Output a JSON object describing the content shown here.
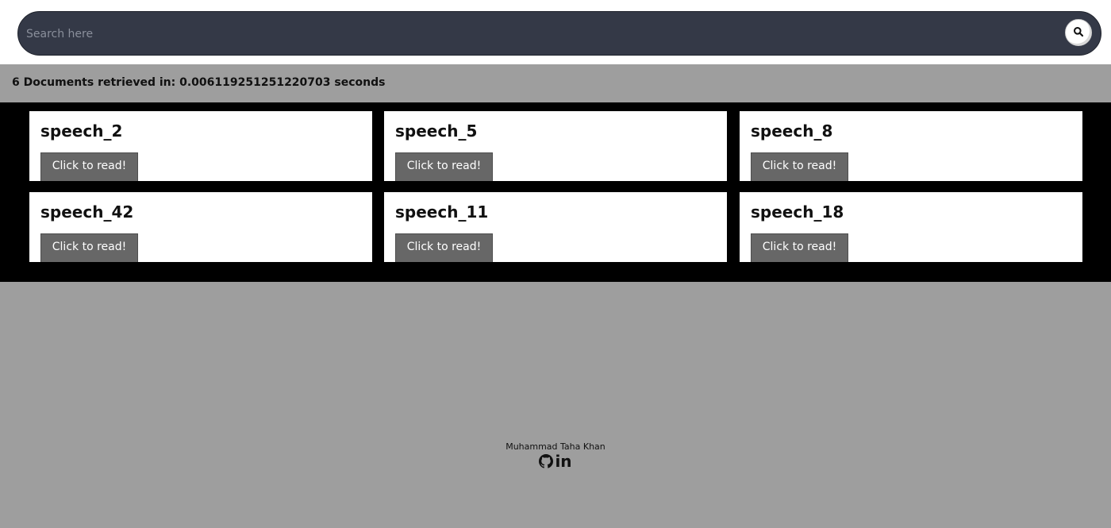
{
  "search": {
    "placeholder": "Search here",
    "value": ""
  },
  "status": {
    "text": "6 Documents retrieved in: 0.006119251251220703 seconds"
  },
  "documents": [
    {
      "title": "speech_2",
      "button_label": "Click to read!"
    },
    {
      "title": "speech_5",
      "button_label": "Click to read!"
    },
    {
      "title": "speech_8",
      "button_label": "Click to read!"
    },
    {
      "title": "speech_42",
      "button_label": "Click to read!"
    },
    {
      "title": "speech_11",
      "button_label": "Click to read!"
    },
    {
      "title": "speech_18",
      "button_label": "Click to read!"
    }
  ],
  "footer": {
    "author": "Muhammad Taha Khan",
    "icons": [
      "github-icon",
      "linkedin-icon"
    ],
    "linkedin_glyph": "in"
  },
  "colors": {
    "search_bar": "#343947",
    "page_background": "#9e9e9e",
    "results_background": "#000000",
    "button": "#676767"
  }
}
